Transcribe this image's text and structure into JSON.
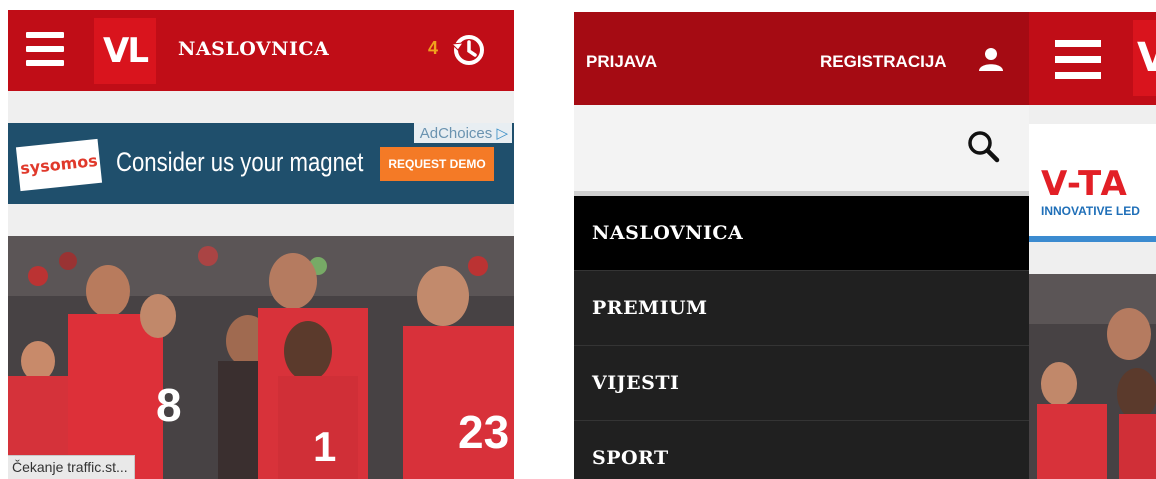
{
  "left_screen": {
    "header": {
      "logo": "VL",
      "home_label": "NASLOVNICA",
      "history_count": "4",
      "menu_icon": "hamburger-icon",
      "history_icon": "history-clock-icon"
    },
    "ad": {
      "adchoices": "AdChoices",
      "brand": "sysomos",
      "headline": "Consider us your magnet",
      "cta": "REQUEST DEMO"
    },
    "status_text": "Čekanje traffic.st..."
  },
  "right_screen": {
    "menu_header": {
      "login": "PRIJAVA",
      "register": "REGISTRACIJA",
      "user_icon": "user-icon"
    },
    "search": {
      "value": "",
      "icon": "search-icon"
    },
    "menu_items": [
      {
        "label": "NASLOVNICA",
        "active": true
      },
      {
        "label": "PREMIUM",
        "active": false
      },
      {
        "label": "VIJESTI",
        "active": false
      },
      {
        "label": "SPORT",
        "active": false
      }
    ],
    "peek_ad": {
      "brand": "V-TA",
      "tagline": "INNOVATIVE LED"
    }
  },
  "colors": {
    "brand_red": "#c00d17",
    "menu_header_red": "#a50b13",
    "menu_bg": "#202020",
    "active_item_bg": "#000000",
    "history_count": "#f0a21d",
    "ad_bg": "#1f4f6c",
    "ad_cta": "#f47a26"
  }
}
